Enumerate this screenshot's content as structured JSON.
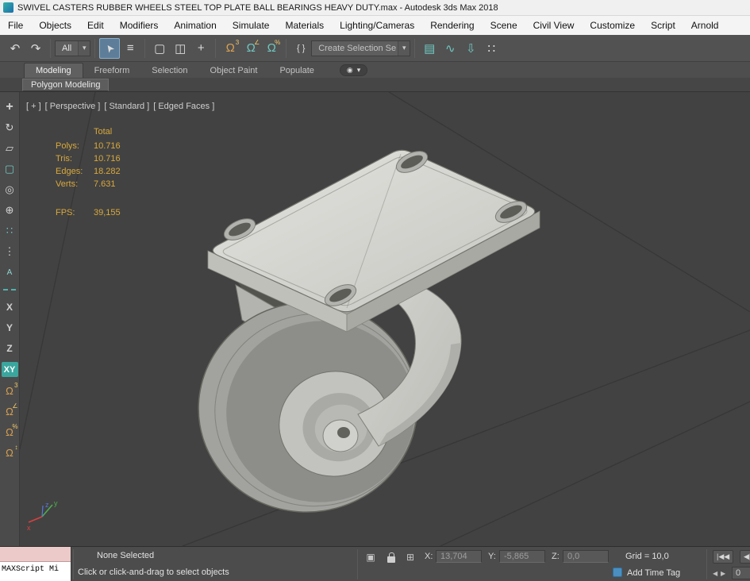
{
  "colors": {
    "accent_teal": "#43b0a8",
    "stats_text": "#d9a93c",
    "selection_highlight": "#5d7d99",
    "viewport_bg": "#424242"
  },
  "title_bar": {
    "title": "SWIVEL CASTERS RUBBER WHEELS STEEL TOP PLATE BALL BEARINGS HEAVY DUTY.max - Autodesk 3ds Max 2018"
  },
  "menu": {
    "items": [
      "File",
      "Objects",
      "Edit",
      "Modifiers",
      "Animation",
      "Simulate",
      "Materials",
      "Lighting/Cameras",
      "Rendering",
      "Scene",
      "Civil View",
      "Customize",
      "Script",
      "Arnold"
    ]
  },
  "toolbar": {
    "selection_filter": "All",
    "selection_set_placeholder": "Create Selection Se",
    "icons": {
      "undo": "↶",
      "redo": "↷",
      "select_object": "➤",
      "select_by_name": "≡",
      "rect_region": "▢",
      "window_crossing": "◫",
      "move": "+",
      "snaps": "Ω",
      "snaps_badge": "3",
      "angle": "Ω",
      "angle_badge": "∠",
      "percent": "Ω",
      "percent_badge": "%",
      "named_sets": "{ }",
      "layer_explorer": "▤",
      "curve_editor": "∿",
      "dope_sheet": "⇩",
      "schematic_view": "∷",
      "dropdown_arrow": "▾"
    }
  },
  "ribbon": {
    "tabs": [
      "Modeling",
      "Freeform",
      "Selection",
      "Object Paint",
      "Populate"
    ],
    "display_icon": "◉",
    "display_arrow": "▾",
    "panel": "Polygon Modeling"
  },
  "left_toolbar": {
    "items": [
      {
        "glyph": "+"
      },
      {
        "glyph": "↻"
      },
      {
        "glyph": "▱"
      },
      {
        "glyph": "▢"
      },
      {
        "glyph": "◎"
      },
      {
        "glyph": "⊕"
      },
      {
        "glyph": "∷"
      },
      {
        "glyph": "⋮"
      },
      {
        "glyph": "A"
      }
    ],
    "axis": {
      "x": "X",
      "y": "Y",
      "z": "Z",
      "xy": "XY"
    },
    "snaps": [
      {
        "glyph": "Ω",
        "badge": "3"
      },
      {
        "glyph": "Ω",
        "badge": "∠"
      },
      {
        "glyph": "Ω",
        "badge": "%"
      },
      {
        "glyph": "Ω",
        "badge": "↕"
      }
    ]
  },
  "viewport": {
    "labels": [
      "[ + ]",
      "[ Perspective ]",
      "[ Standard ]",
      "[ Edged Faces ]"
    ],
    "stats": {
      "total": "Total",
      "rows": [
        {
          "label": "Polys:",
          "value": "10.716"
        },
        {
          "label": "Tris:",
          "value": "10.716"
        },
        {
          "label": "Edges:",
          "value": "18.282"
        },
        {
          "label": "Verts:",
          "value": "7.631"
        }
      ],
      "fps_label": "FPS:",
      "fps_value": "39,155"
    },
    "axis_gizmo": {
      "x": "x",
      "y": "y",
      "z": "z"
    }
  },
  "status_bar": {
    "maxscript_text": "MAXScript Mi",
    "selection_status": "None Selected",
    "prompt": "Click or click-and-drag to select objects",
    "coords": {
      "x_label": "X:",
      "x": "13,704",
      "y_label": "Y:",
      "y": "-5,865",
      "z_label": "Z:",
      "z": "0,0"
    },
    "grid_label": "Grid = 10,0",
    "time_tag": "Add Time Tag",
    "frame": "0",
    "playback": {
      "start": "|◀◀",
      "prev": "◀|",
      "left": "◀",
      "right": "▶"
    }
  }
}
